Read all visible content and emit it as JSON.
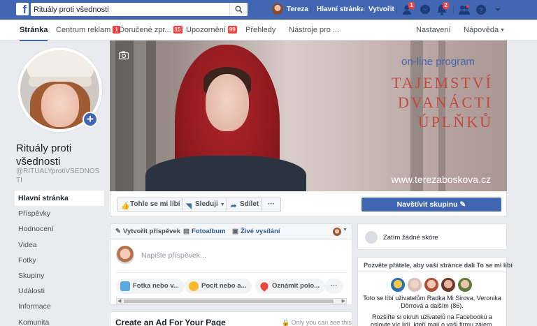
{
  "topbar": {
    "search_value": "Rituály proti všednosti",
    "user_name": "Tereza",
    "home_label": "Hlavní stránka",
    "create_label": "Vytvořit",
    "friend_requests_badge": "1",
    "notifications_badge": "2",
    "brand_color": "#4267b2"
  },
  "page_tabs": [
    {
      "label": "Stránka",
      "badge": ""
    },
    {
      "label": "Centrum reklam",
      "badge": "1"
    },
    {
      "label": "Doručené zpr...",
      "badge": "15"
    },
    {
      "label": "Upozornění",
      "badge": "99"
    },
    {
      "label": "Přehledy",
      "badge": ""
    },
    {
      "label": "Nástroje pro ...",
      "badge": ""
    }
  ],
  "page_tabs_right": {
    "settings": "Nastavení",
    "help": "Nápověda"
  },
  "profile": {
    "name": "Rituály proti všednosti",
    "handle": "@RITUALYprotiVSEDNOSTI"
  },
  "side_nav": [
    "Hlavní stránka",
    "Příspěvky",
    "Hodnocení",
    "Videa",
    "Fotky",
    "Skupiny",
    "Události",
    "Informace",
    "Komunita"
  ],
  "cover": {
    "tagline": "on-line program",
    "title_lines": [
      "TAJEMSTVÍ",
      "DVANÁCTI",
      "ÚPLŇKŮ"
    ],
    "url": "www.terezaboskova.cz"
  },
  "actions": {
    "like": "Tohle se mi líbí",
    "follow": "Sleduji",
    "share": "Sdílet",
    "more": "···",
    "visit_group": "Navštívit skupinu"
  },
  "composer": {
    "tab_create": "Vytvořit příspěvek",
    "tab_photo": "Fotoalbum",
    "tab_live": "Živé vysílání",
    "placeholder": "Napište příspěvek...",
    "pills": [
      "Fotka nebo v...",
      "Pocit nebo a...",
      "Oznámit polo..."
    ],
    "more": "···"
  },
  "ad_box": {
    "title": "Create an Ad For Your Page",
    "note": "Only you can see this"
  },
  "right": {
    "score_text": "Zatím žádné skóre",
    "invite_title": "Pozvěte přátele, aby vaší stránce dali To se mi líbí",
    "invite_text": "Toto se líbí uživatelům Radka Mi Sirova, Veronika Dörrová a dalším (86).",
    "invite_text2": "Rozšiřte si okruh uživatelů na Facebooku a oslovte víc lidí, kteří mají o vaši firmu zájem."
  }
}
